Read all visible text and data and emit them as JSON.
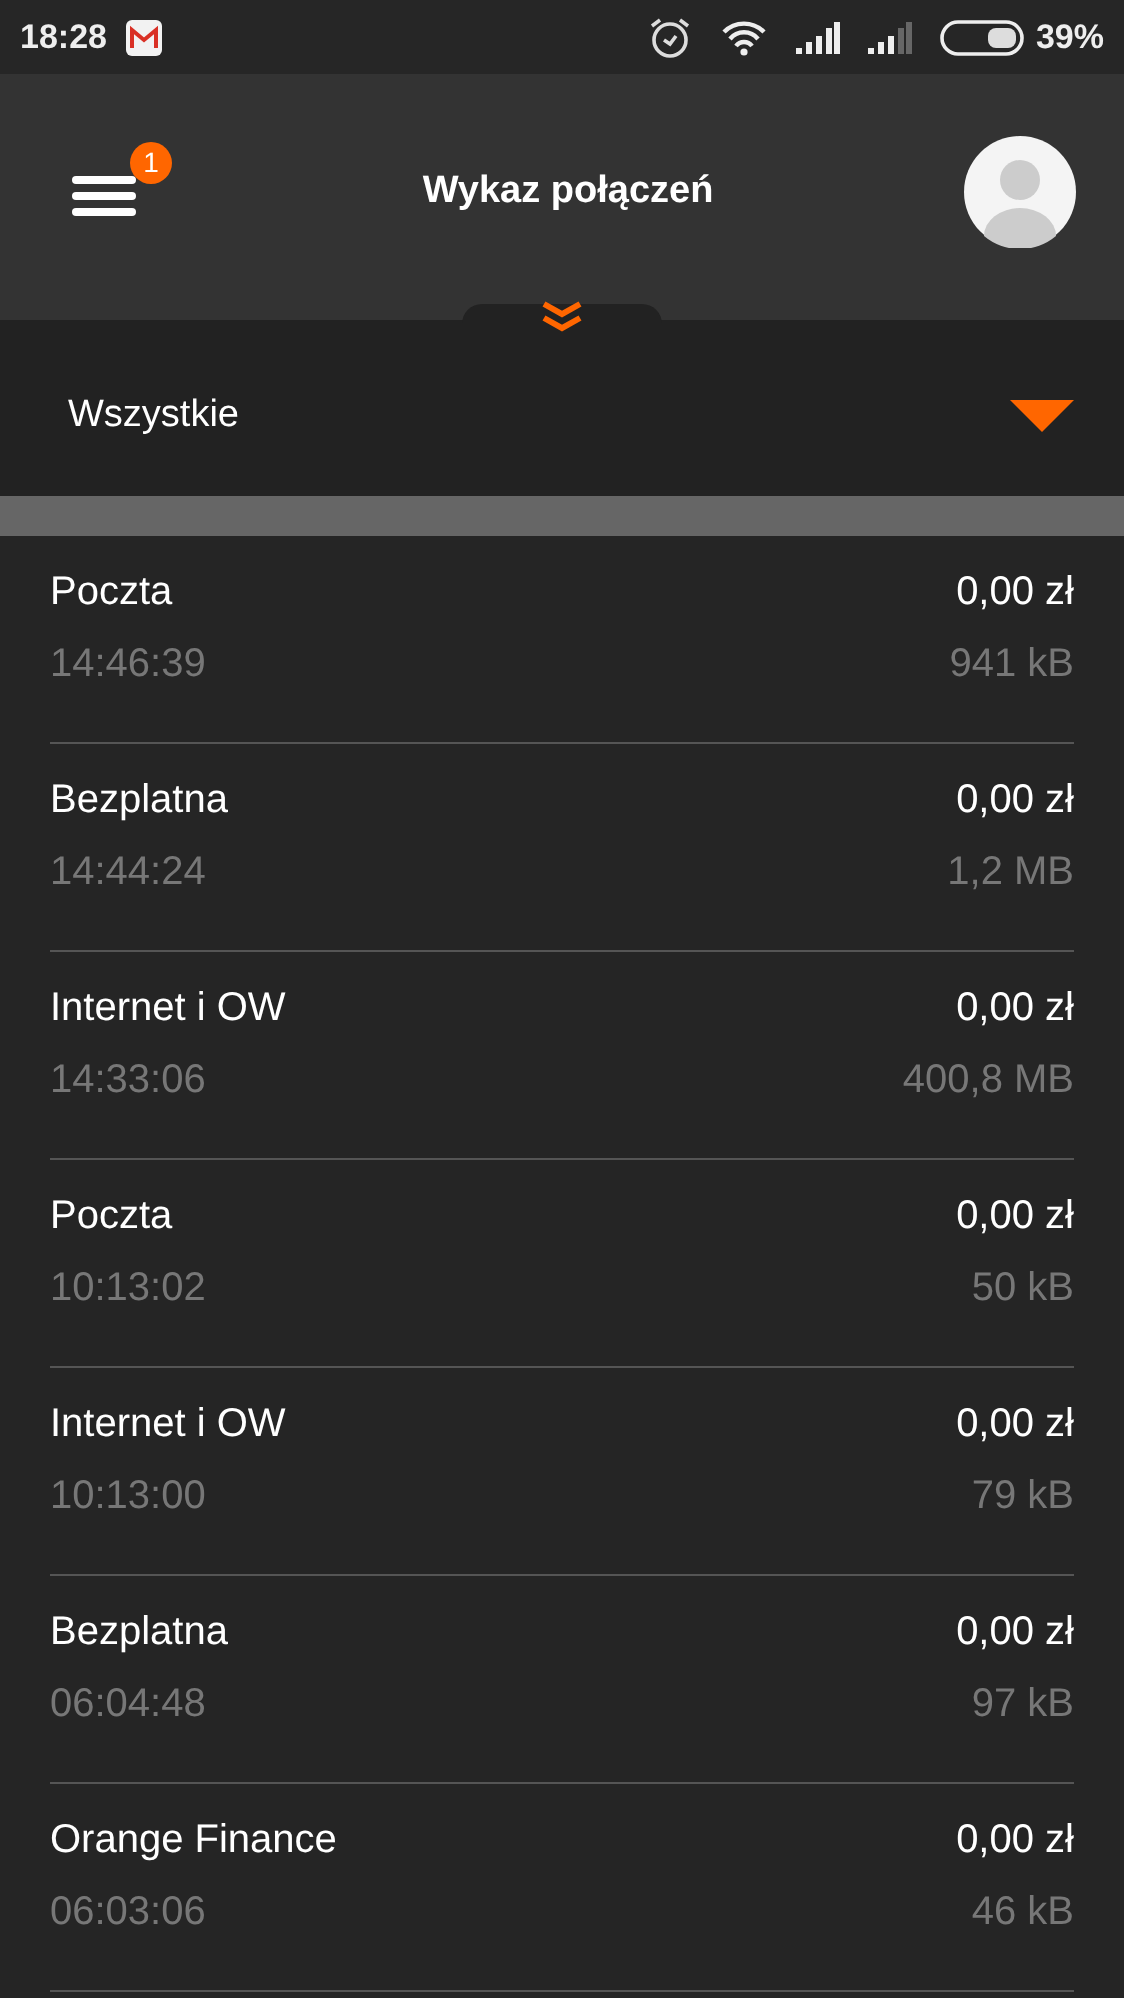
{
  "status_bar": {
    "time": "18:28",
    "battery": "39%"
  },
  "header": {
    "title": "Wykaz połączeń",
    "menu_badge": "1"
  },
  "filter": {
    "value": "Wszystkie"
  },
  "connections": [
    {
      "name": "Poczta",
      "time": "14:46:39",
      "cost": "0,00 zł",
      "usage": "941 kB"
    },
    {
      "name": "Bezplatna",
      "time": "14:44:24",
      "cost": "0,00 zł",
      "usage": "1,2 MB"
    },
    {
      "name": "Internet i OW",
      "time": "14:33:06",
      "cost": "0,00 zł",
      "usage": "400,8 MB"
    },
    {
      "name": "Poczta",
      "time": "10:13:02",
      "cost": "0,00 zł",
      "usage": "50 kB"
    },
    {
      "name": "Internet i OW",
      "time": "10:13:00",
      "cost": "0,00 zł",
      "usage": "79 kB"
    },
    {
      "name": "Bezplatna",
      "time": "06:04:48",
      "cost": "0,00 zł",
      "usage": "97 kB"
    },
    {
      "name": "Orange Finance",
      "time": "06:03:06",
      "cost": "0,00 zł",
      "usage": "46 kB"
    }
  ]
}
